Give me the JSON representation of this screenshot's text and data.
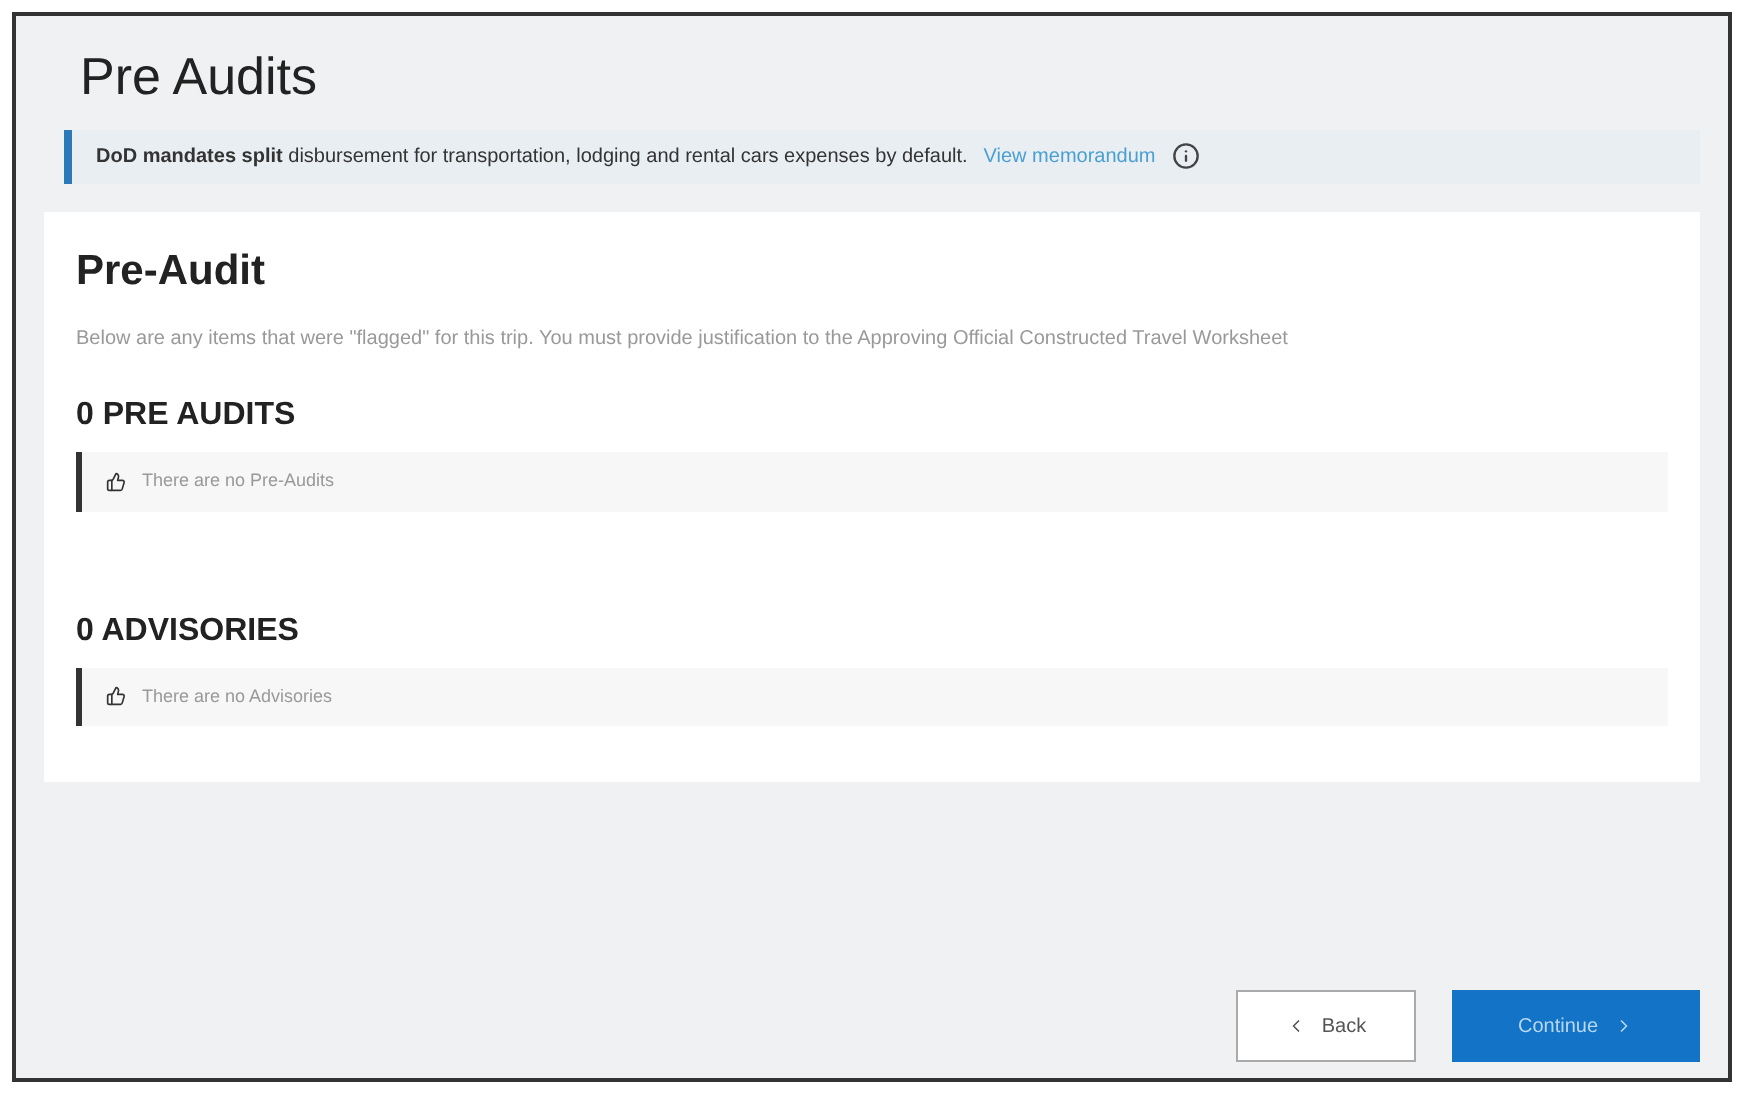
{
  "page_title": "Pre Audits",
  "notice": {
    "text": "**DoD mandates split** disbursement for transportation, lodging and rental cars expenses by default.",
    "link": "View memorandum"
  },
  "card": {
    "title": "Pre-Audit",
    "description": "Below are any items that were \"flagged\" for this trip. You must provide justification to the Approving Official Constructed Travel Worksheet",
    "sections": [
      {
        "heading": "0 PRE AUDITS",
        "message": "There are no Pre-Audits"
      },
      {
        "heading": "0 ADVISORIES",
        "message": "There are no Advisories"
      }
    ]
  },
  "buttons": [
    {
      "label": "Back",
      "kind": "secondary"
    },
    {
      "label": "Continue",
      "kind": "primary"
    }
  ]
}
